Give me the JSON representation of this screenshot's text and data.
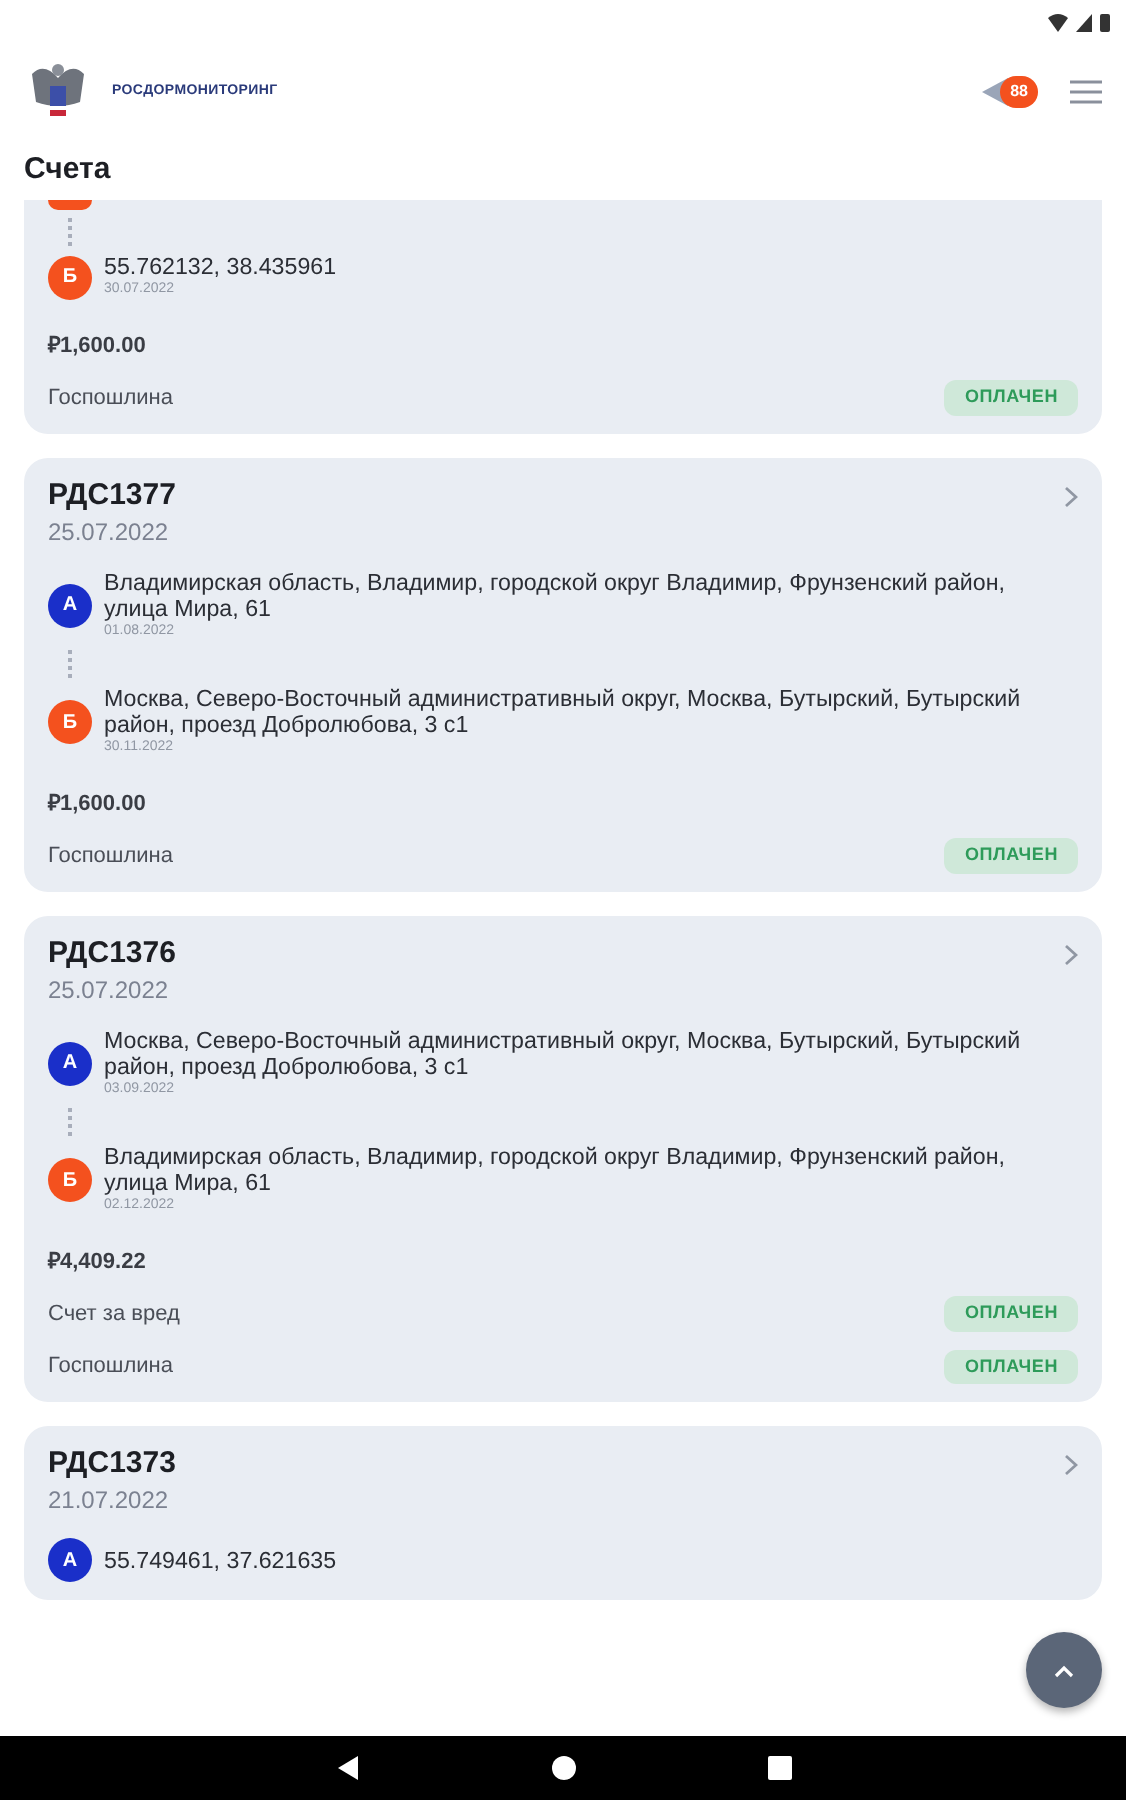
{
  "header": {
    "logo_text": "РОСДОРМОНИТОРИНГ",
    "notification_count": "88"
  },
  "page_title": "Счета",
  "invoices": [
    {
      "partial": true,
      "stops": [
        {
          "letter": "Б",
          "color": "#f4511e",
          "address": "55.762132, 38.435961",
          "date": "30.07.2022"
        }
      ],
      "amount": "₽1,600.00",
      "charges": [
        {
          "label": "Госпошлина",
          "status": "ОПЛАЧЕН"
        }
      ]
    },
    {
      "partial": false,
      "number": "РДС1377",
      "date": "25.07.2022",
      "stops": [
        {
          "letter": "А",
          "color": "#1a2fc9",
          "address": "Владимирская область, Владимир, городской округ Владимир, Фрунзенский район, улица Мира, 61",
          "date": "01.08.2022"
        },
        {
          "letter": "Б",
          "color": "#f4511e",
          "address": "Москва, Северо-Восточный административный округ, Москва, Бутырский, Бутырский район, проезд Добролюбова, 3 с1",
          "date": "30.11.2022"
        }
      ],
      "amount": "₽1,600.00",
      "charges": [
        {
          "label": "Госпошлина",
          "status": "ОПЛАЧЕН"
        }
      ]
    },
    {
      "partial": false,
      "number": "РДС1376",
      "date": "25.07.2022",
      "stops": [
        {
          "letter": "А",
          "color": "#1a2fc9",
          "address": "Москва, Северо-Восточный административный округ, Москва, Бутырский, Бутырский район, проезд Добролюбова, 3 с1",
          "date": "03.09.2022"
        },
        {
          "letter": "Б",
          "color": "#f4511e",
          "address": "Владимирская область, Владимир, городской округ Владимир, Фрунзенский район, улица Мира, 61",
          "date": "02.12.2022"
        }
      ],
      "amount": "₽4,409.22",
      "charges": [
        {
          "label": "Счет за вред",
          "status": "ОПЛАЧЕН"
        },
        {
          "label": "Госпошлина",
          "status": "ОПЛАЧЕН"
        }
      ]
    },
    {
      "partial": false,
      "number": "РДС1373",
      "date": "21.07.2022",
      "stops": [
        {
          "letter": "А",
          "color": "#1a2fc9",
          "address": "55.749461, 37.621635"
        }
      ]
    }
  ]
}
